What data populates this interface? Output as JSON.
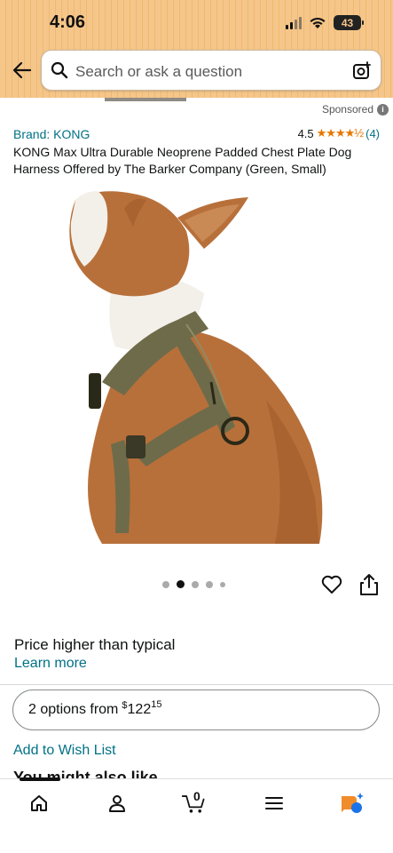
{
  "status_bar": {
    "time": "4:06",
    "battery": "43"
  },
  "search": {
    "placeholder": "Search or ask a question"
  },
  "product": {
    "sponsored_label": "Sponsored",
    "brand": "Brand: KONG",
    "rating_value": "4.5",
    "rating_stars": "★★★★½",
    "rating_count": "(4)",
    "title": "KONG Max Ultra Durable Neoprene Padded Chest Plate Dog Harness Offered by The Barker Company (Green, Small)",
    "image_count": 5,
    "active_image_index": 1
  },
  "pricing": {
    "note": "Price higher than typical",
    "learn_more": "Learn more",
    "options_label": "2 options from",
    "currency": "$",
    "price_whole": "122",
    "price_fraction": "15"
  },
  "actions": {
    "wishlist": "Add to Wish List",
    "next_section_peek": "You might also like"
  },
  "bottom_nav": {
    "cart_count": "0",
    "items": [
      "home-icon",
      "account-icon",
      "cart-icon",
      "menu-icon",
      "rufus-icon"
    ]
  },
  "colors": {
    "header_bg": "#f5c68a",
    "link": "#007185",
    "star": "#e77600",
    "rufus_orange": "#f08c2a",
    "rufus_blue": "#1a73e8"
  }
}
